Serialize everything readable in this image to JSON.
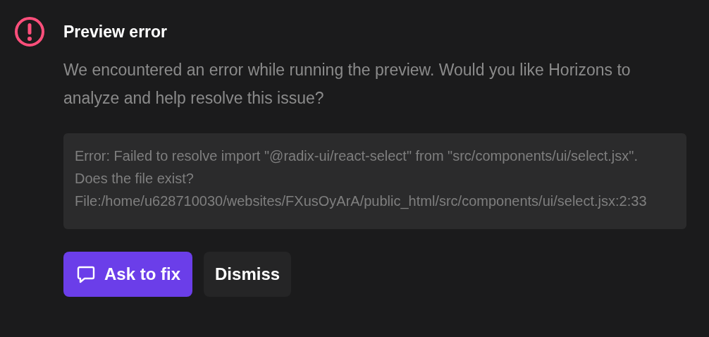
{
  "title": "Preview error",
  "message": "We encountered an error while running the preview. Would you like Horizons to analyze and help resolve this issue?",
  "error_details": "Error: Failed to resolve import \"@radix-ui/react-select\" from \"src/components/ui/select.jsx\". Does the file exist? File:/home/u628710030/websites/FXusOyArA/public_html/src/components/ui/select.jsx:2:33",
  "buttons": [
    {
      "label": "Ask to fix",
      "kind": "primary"
    },
    {
      "label": "Dismiss",
      "kind": "secondary"
    }
  ]
}
